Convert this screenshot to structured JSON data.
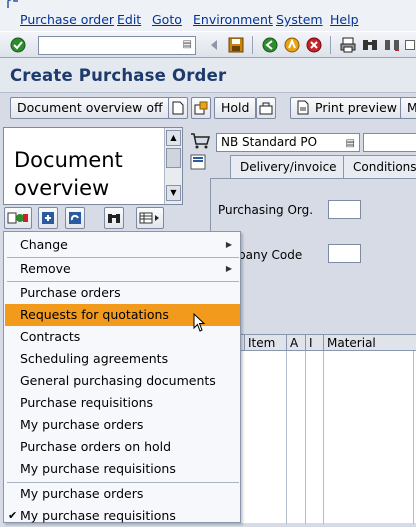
{
  "menubar": {
    "items": [
      "Purchase order",
      "Edit",
      "Goto",
      "Environment",
      "System",
      "Help"
    ]
  },
  "toolbar": {
    "command_value": "",
    "icons": [
      "enter-icon",
      "save-icon",
      "back-icon",
      "exit-icon",
      "cancel-icon",
      "print-icon",
      "find-icon",
      "find-next-icon"
    ]
  },
  "page": {
    "title": "Create Purchase Order"
  },
  "app_toolbar": {
    "document_overview_off": "Document overview off",
    "hold": "Hold",
    "print_preview": "Print preview",
    "more": "M"
  },
  "doc_panel": {
    "title_line1": "Document",
    "title_line2": "overview"
  },
  "header": {
    "order_type": "NB Standard PO",
    "tabs": [
      "Delivery/invoice",
      "Conditions"
    ],
    "fields": {
      "purchasing_org": "Purchasing Org.",
      "company_code": "pany Code"
    }
  },
  "grid": {
    "columns": [
      "Item",
      "A",
      "I",
      "Material"
    ]
  },
  "context_menu": {
    "items": [
      {
        "label": "Change",
        "submenu": true
      },
      {
        "label": "Remove",
        "submenu": true
      },
      {
        "label": "Purchase orders"
      },
      {
        "label": "Requests for quotations",
        "highlighted": true
      },
      {
        "label": "Contracts"
      },
      {
        "label": "Scheduling agreements"
      },
      {
        "label": "General purchasing documents"
      },
      {
        "label": "Purchase requisitions"
      },
      {
        "label": "My purchase orders"
      },
      {
        "label": "Purchase orders on hold"
      },
      {
        "label": "My purchase requisitions"
      },
      {
        "label": "My purchase orders"
      },
      {
        "label": "My purchase requisitions",
        "checked": true
      }
    ],
    "highlight_color": "#f29a1b"
  },
  "colors": {
    "menu_text": "#003399",
    "title_text": "#1c3a6b",
    "background": "#d6dbe6"
  }
}
